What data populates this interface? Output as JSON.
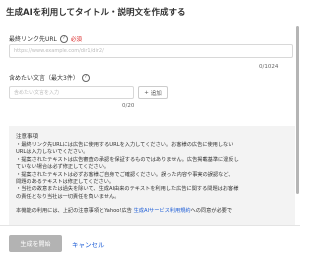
{
  "dialog": {
    "title": "生成AIを利用してタイトル・説明文を作成する"
  },
  "url_field": {
    "label": "最終リンク先URL",
    "required_label": "必須",
    "placeholder": "https://www.example.com/dir1/dir2/",
    "counter": "0/1024"
  },
  "text_field": {
    "label": "含めたい文言（最大3件）",
    "placeholder": "含めたい文言を入力",
    "counter": "0/20",
    "add_label": "追加"
  },
  "notice": {
    "title": "注意事項",
    "lines": [
      "・最終リンク先URLには広告に使用するURLを入力してください。お客様の広告に使用しない",
      "URLは入力しないでください。",
      "・提案されたテキストは広告審査の承認を保証するものではありません。広告掲載基準に違反し",
      "ていない場合は必ず修正してください。",
      "・提案されたテキストは必ずお客様ご自身でご確認ください。誤った内容や事実の誤認など、",
      "問題のあるテキストは修正してください。",
      "・当社の故意または過失を除いて、生成AI由来のテキストを利用した広告に関する問題はお客様",
      "の責任となり当社は一切責任を負いません。"
    ],
    "footer_prefix": "本機能の利用には、上記の注意事項とYahoo!広告 ",
    "footer_link": "生成AIサービス利用規約",
    "footer_suffix": "への同意が必要で"
  },
  "footer": {
    "create_label": "生成を開始",
    "cancel_label": "キャンセル"
  },
  "colors": {
    "accent_link": "#1a5bd6",
    "required": "#d81b1b",
    "disabled_button": "#b3b3b3"
  }
}
